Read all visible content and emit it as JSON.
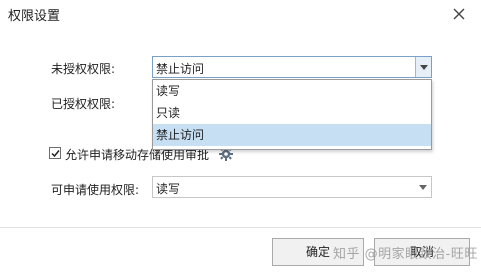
{
  "dialog": {
    "title": "权限设置",
    "close_icon": "close-icon"
  },
  "form": {
    "unauthorized_label": "未授权权限:",
    "unauthorized_value": "禁止访问",
    "authorized_label": "已授权权限:",
    "dropdown_options": [
      "读写",
      "只读",
      "禁止访问"
    ],
    "dropdown_selected_index": 2,
    "checkbox_label": "允许申请移动存储使用审批",
    "checkbox_checked": true,
    "gear_icon": "gear-icon",
    "applicable_label": "可申请使用权限:",
    "applicable_value": "读写"
  },
  "buttons": {
    "ok_label": "确定",
    "cancel_label": "取消"
  },
  "watermark": {
    "text": "知乎 @明家眼致治-旺旺"
  },
  "colors": {
    "selected_option_bg": "#c7dff3",
    "focus_border": "#7aa0c8"
  }
}
